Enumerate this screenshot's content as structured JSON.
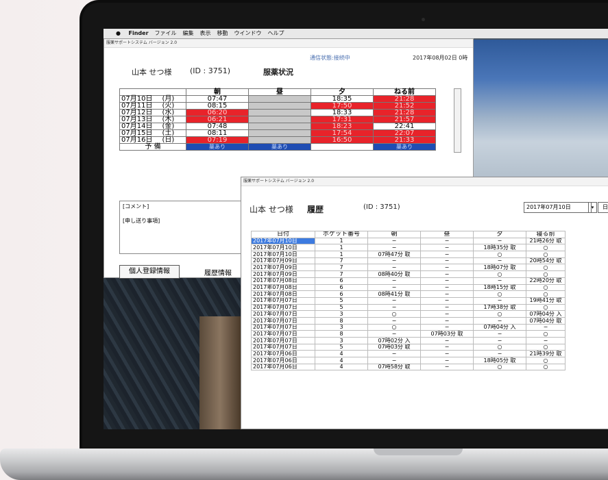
{
  "menubar": {
    "apple": "",
    "items": [
      "Finder",
      "ファイル",
      "編集",
      "表示",
      "移動",
      "ウインドウ",
      "ヘルプ"
    ]
  },
  "window1": {
    "title": "服薬サポートシステム バージョン 2.0",
    "patient_name": "山本 せつ様",
    "patient_id": "(ID : 3751)",
    "heading": "服薬状況",
    "status": "通信状態:接続中",
    "datetime": "2017年08月02日 0時",
    "columns": [
      "",
      "朝",
      "昼",
      "夕",
      "ねる前"
    ],
    "rows": [
      {
        "date": "07月10日",
        "dow": "(月)",
        "morning": "07:47",
        "noon": "",
        "evening": "18:35",
        "bed": "21:28",
        "m_color": "none",
        "e_color": "none",
        "b_color": "red"
      },
      {
        "date": "07月11日",
        "dow": "(火)",
        "morning": "08:15",
        "noon": "",
        "evening": "17:50",
        "bed": "21:52",
        "m_color": "none",
        "e_color": "red",
        "b_color": "red"
      },
      {
        "date": "07月12日",
        "dow": "(水)",
        "morning": "06:20",
        "noon": "",
        "evening": "18:33",
        "bed": "21:28",
        "m_color": "red",
        "e_color": "none",
        "b_color": "red"
      },
      {
        "date": "07月13日",
        "dow": "(木)",
        "morning": "06:21",
        "noon": "",
        "evening": "17:31",
        "bed": "21:57",
        "m_color": "red",
        "e_color": "red",
        "b_color": "red"
      },
      {
        "date": "07月14日",
        "dow": "(金)",
        "morning": "07:48",
        "noon": "",
        "evening": "18:23",
        "bed": "22:41",
        "m_color": "none",
        "e_color": "red",
        "b_color": "none"
      },
      {
        "date": "07月15日",
        "dow": "(土)",
        "morning": "08:11",
        "noon": "",
        "evening": "17:54",
        "bed": "22:07",
        "m_color": "none",
        "e_color": "red",
        "b_color": "red"
      },
      {
        "date": "07月16日",
        "dow": "(日)",
        "morning": "07:19",
        "noon": "",
        "evening": "16:50",
        "bed": "21:33",
        "m_color": "red",
        "e_color": "red",
        "b_color": "red"
      }
    ],
    "reserve_label": "予 備",
    "reserve_cells": [
      "薬あり",
      "薬あり",
      "",
      "薬あり"
    ],
    "comment_label": "[コメント]",
    "handover_label": "[申し送り事項]",
    "btn_personal": "個人登録情報",
    "btn_history": "履歴情報"
  },
  "window2": {
    "title": "服薬サポートシステム バージョン 2.0",
    "patient_name": "山本 せつ様",
    "heading": "履歴",
    "patient_id": "(ID : 3751)",
    "date_select": "2017年07月10日",
    "dropdown_glyph": "▾",
    "btn_partial": "日",
    "columns": [
      "日付",
      "ポケット番号",
      "朝",
      "昼",
      "夕",
      "寝る前"
    ],
    "rows": [
      [
        "2017年07月10日",
        "1",
        "−",
        "−",
        "−",
        "21時26分 取"
      ],
      [
        "2017年07月10日",
        "1",
        "−",
        "−",
        "18時35分 取",
        "○"
      ],
      [
        "2017年07月10日",
        "1",
        "07時47分 取",
        "−",
        "○",
        "○"
      ],
      [
        "2017年07月09日",
        "7",
        "−",
        "−",
        "−",
        "20時54分 取"
      ],
      [
        "2017年07月09日",
        "7",
        "−",
        "−",
        "18時07分 取",
        "○"
      ],
      [
        "2017年07月09日",
        "7",
        "08時40分 取",
        "−",
        "○",
        "○"
      ],
      [
        "2017年07月08日",
        "6",
        "−",
        "−",
        "−",
        "22時20分 取"
      ],
      [
        "2017年07月08日",
        "6",
        "−",
        "−",
        "18時15分 取",
        "○"
      ],
      [
        "2017年07月08日",
        "6",
        "08時41分 取",
        "−",
        "○",
        "○"
      ],
      [
        "2017年07月07日",
        "5",
        "−",
        "−",
        "−",
        "19時41分 取"
      ],
      [
        "2017年07月07日",
        "5",
        "−",
        "−",
        "17時38分 取",
        "○"
      ],
      [
        "2017年07月07日",
        "3",
        "○",
        "−",
        "○",
        "07時04分 入"
      ],
      [
        "2017年07月07日",
        "8",
        "−",
        "−",
        "−",
        "07時04分 取"
      ],
      [
        "2017年07月07日",
        "3",
        "○",
        "−",
        "07時04分 入",
        "−"
      ],
      [
        "2017年07月07日",
        "8",
        "−",
        "07時03分 取",
        "−",
        "○"
      ],
      [
        "2017年07月07日",
        "3",
        "07時02分 入",
        "−",
        "−",
        "−"
      ],
      [
        "2017年07月07日",
        "5",
        "07時03分 取",
        "−",
        "○",
        "○"
      ],
      [
        "2017年07月06日",
        "4",
        "−",
        "−",
        "−",
        "21時39分 取"
      ],
      [
        "2017年07月06日",
        "4",
        "−",
        "−",
        "18時05分 取",
        "○"
      ],
      [
        "2017年07月06日",
        "4",
        "07時58分 取",
        "−",
        "○",
        "○"
      ]
    ]
  }
}
